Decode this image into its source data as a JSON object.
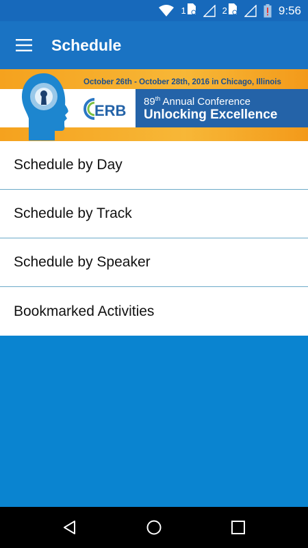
{
  "status_bar": {
    "sim1": "1",
    "sim2": "2",
    "time": "9:56",
    "icons": [
      "wifi-icon",
      "sim-card-icon",
      "signal-icon",
      "sim-card-icon",
      "signal-icon",
      "battery-alert-icon"
    ]
  },
  "app_bar": {
    "title": "Schedule",
    "menu_icon": "hamburger-menu-icon"
  },
  "banner": {
    "dates": "October 26th - October 28th, 2016 in Chicago, Illinois",
    "logo_text": "ERB",
    "conference_num": "89",
    "conference_sup": "th",
    "conference_text": " Annual Conference",
    "tagline": "Unlocking Excellence"
  },
  "menu": {
    "items": [
      {
        "label": "Schedule by Day"
      },
      {
        "label": "Schedule by Track"
      },
      {
        "label": "Schedule by Speaker"
      },
      {
        "label": "Bookmarked Activities"
      }
    ]
  },
  "nav_bar": {
    "icons": [
      "back-icon",
      "home-icon",
      "recents-icon"
    ]
  },
  "colors": {
    "status_bar": "#1769bb",
    "app_bar": "#1a73c3",
    "background": "#0a84d0",
    "divider": "#6aa9c8"
  }
}
